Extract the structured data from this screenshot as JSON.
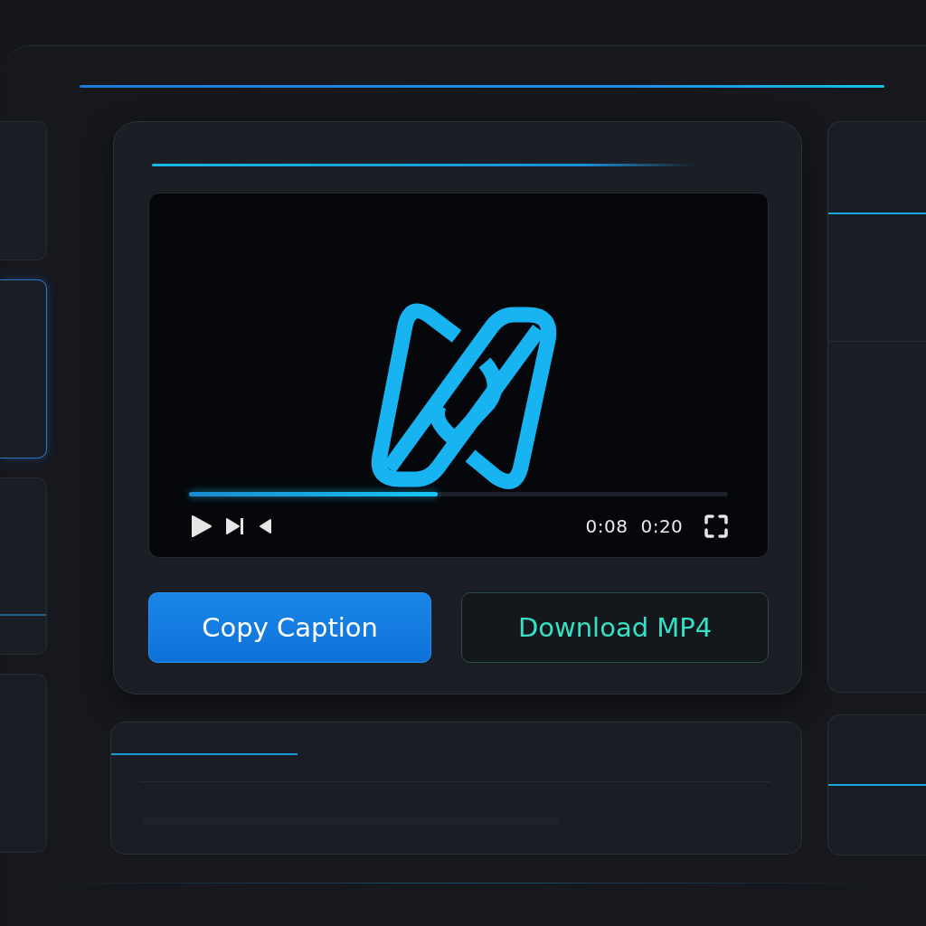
{
  "player": {
    "progress": {
      "level": 0.46
    },
    "elapsed": "0:08",
    "duration": "0:20"
  },
  "buttons": [
    {
      "label": "Copy Caption",
      "kind": "primary"
    },
    {
      "label": "Download MP4",
      "kind": "secondary"
    }
  ]
}
